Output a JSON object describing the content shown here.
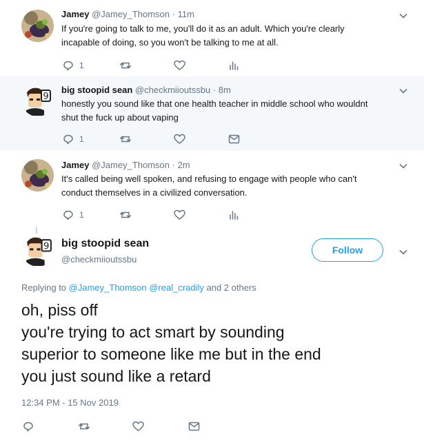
{
  "tweets": [
    {
      "name": "Jamey",
      "handle": "@Jamey_Thomson",
      "time": "· 11m",
      "lines": [
        "If you're going to talk to me, you'll do it as an adult. Which you're clearly",
        "incapable of doing, so you won't be talking to me at all."
      ],
      "reply_count": "1"
    },
    {
      "name": "big stoopid sean",
      "handle": "@checkmiioutssbu",
      "time": "· 8m",
      "lines": [
        "honestly you sound like that one health teacher in middle school who wouldnt",
        "shut the fuck up about vaping"
      ],
      "reply_count": "1"
    },
    {
      "name": "Jamey",
      "handle": "@Jamey_Thomson",
      "time": "· 2m",
      "lines": [
        "It's called being well spoken, and refusing to engage with people who can't",
        "conduct themselves in a civilized conversation."
      ],
      "reply_count": "1"
    }
  ],
  "main": {
    "name": "big stoopid sean",
    "handle": "@checkmiioutssbu",
    "follow_label": "Follow",
    "replying_prefix": "Replying to",
    "replying_user1": "@Jamey_Thomson",
    "replying_user2": "@real_cradily",
    "replying_suffix": "and 2 others",
    "text_lines": [
      "oh, piss off",
      "you're trying to act smart by sounding",
      "superior to someone like me but in the end",
      "you just sound like a retard"
    ],
    "timestamp": "12:34 PM - 15 Nov 2019"
  },
  "colors": {
    "accent": "#1da1f2",
    "muted": "#657786",
    "icon": "#657786",
    "thread_line": "#cbd6df",
    "highlight_bg": "#f5f8fa"
  }
}
